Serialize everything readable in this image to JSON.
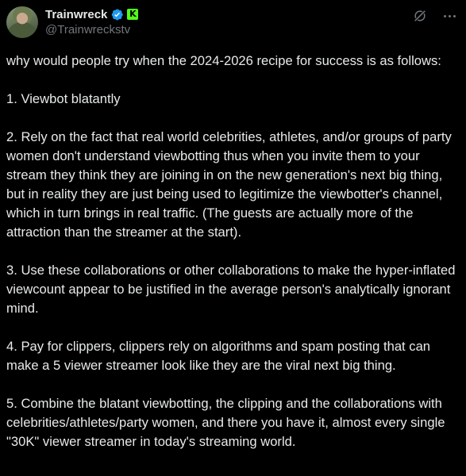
{
  "post": {
    "author": {
      "display_name": "Trainwreck",
      "handle": "@Trainwreckstv",
      "verified_icon": "verified-badge-icon",
      "affiliate_badge": "K"
    },
    "actions": {
      "grok_icon": "grok-icon",
      "more_icon": "more-options-icon"
    },
    "paragraphs": [
      "why would people try when the 2024-2026 recipe for success is as follows:",
      "1. Viewbot blatantly",
      "2. Rely on the fact that real world celebrities, athletes, and/or groups of party women don't understand viewbotting thus when you invite them to your stream they think they are joining in on the new generation's next big thing, but in reality they are just being used to legitimize the viewbotter's channel, which in turn brings in real traffic. (The guests are actually more of the attraction than the streamer at the start).",
      "3. Use these collaborations or other collaborations to make the hyper-inflated viewcount appear to be justified in the average person's analytically ignorant mind.",
      "4. Pay for clippers, clippers rely on algorithms and spam posting that can make a 5 viewer streamer look like they are the viral next big thing.",
      "5. Combine the blatant viewbotting, the clipping and the collaborations with celebrities/athletes/party women, and there you have it, almost every single \"30K\" viewer streamer in today's streaming world."
    ],
    "colors": {
      "background": "#000000",
      "text": "#e7e9ea",
      "muted": "#71767b",
      "verified": "#1d9bf0",
      "kick_green": "#53fc18"
    }
  }
}
